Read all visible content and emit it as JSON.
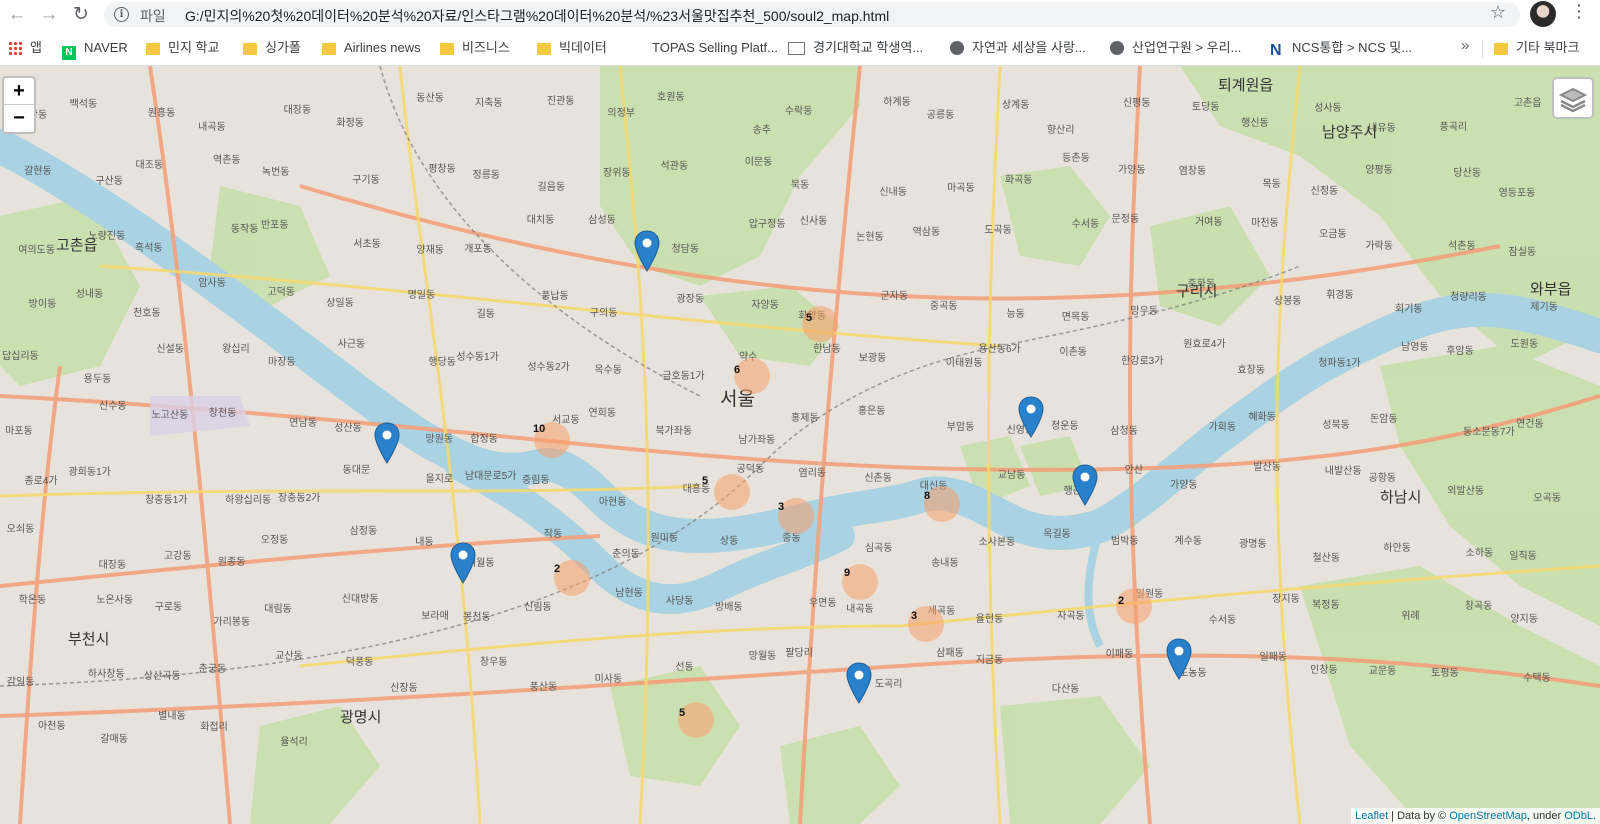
{
  "browser": {
    "scheme_label": "파일",
    "url": "G:/민지의%20첫%20데이터%20분석%20자료/인스타그램%20데이터%20분석/%23서울맛집추천_500/soul2_map.html",
    "bookmarks": [
      {
        "label": "앱",
        "icon": "apps-grid-icon"
      },
      {
        "label": "NAVER",
        "icon": "naver-icon"
      },
      {
        "label": "민지 학교",
        "icon": "folder-icon"
      },
      {
        "label": "싱가폴",
        "icon": "folder-icon"
      },
      {
        "label": "Airlines news",
        "icon": "folder-icon"
      },
      {
        "label": "비즈니스",
        "icon": "folder-icon"
      },
      {
        "label": "빅데이터",
        "icon": "folder-icon"
      },
      {
        "label": "TOPAS Selling Platf...",
        "icon": "none"
      },
      {
        "label": "경기대학교 학생역...",
        "icon": "mail-icon"
      },
      {
        "label": "자연과 세상을 사랑...",
        "icon": "globe-icon"
      },
      {
        "label": "산업연구원 > 우리...",
        "icon": "globe-icon"
      },
      {
        "label": "NCS통합 > NCS 및...",
        "icon": "ncs-icon"
      },
      {
        "label": "기타 북마크",
        "icon": "folder-icon"
      }
    ],
    "more_label": "»"
  },
  "map": {
    "zoom_in": "+",
    "zoom_out": "−",
    "clusters": [
      {
        "count": "5"
      },
      {
        "count": "6"
      },
      {
        "count": "10"
      },
      {
        "count": "5"
      },
      {
        "count": "3"
      },
      {
        "count": "8"
      },
      {
        "count": "2"
      },
      {
        "count": "9"
      },
      {
        "count": "3"
      },
      {
        "count": "2"
      },
      {
        "count": "5"
      }
    ],
    "marker_count": 8,
    "marker_color": "#2a81cb",
    "cluster_color": "#f79e69",
    "cities": [
      "퇴계원읍",
      "남양주시",
      "구리시",
      "와부읍",
      "하남시",
      "서울",
      "고촌읍",
      "부천시",
      "광명시"
    ],
    "places": [
      "장항동",
      "백석동",
      "원흥동",
      "내곡동",
      "대장동",
      "화정동",
      "동산동",
      "지축동",
      "진관동",
      "의정부",
      "호원동",
      "송추",
      "수락동",
      "하계동",
      "공릉동",
      "상계동",
      "향산리",
      "신평동",
      "토당동",
      "행신동",
      "성사동",
      "내유동",
      "풍곡리",
      "고촌읍",
      "갈현동",
      "구산동",
      "대조동",
      "역촌동",
      "녹번동",
      "구기동",
      "평창동",
      "정릉동",
      "길음동",
      "장위동",
      "석관동",
      "이문동",
      "묵동",
      "신내동",
      "마곡동",
      "화곡동",
      "등촌동",
      "가양동",
      "염창동",
      "목동",
      "신정동",
      "양평동",
      "당산동",
      "영등포동",
      "여의도동",
      "노량진동",
      "흑석동",
      "동작동",
      "반포동",
      "서초동",
      "양재동",
      "개포동",
      "대치동",
      "삼성동",
      "청담동",
      "압구정동",
      "신사동",
      "논현동",
      "역삼동",
      "도곡동",
      "수서동",
      "문정동",
      "거여동",
      "마천동",
      "오금동",
      "가락동",
      "석촌동",
      "잠실동",
      "방이동",
      "성내동",
      "천호동",
      "암사동",
      "고덕동",
      "상일동",
      "명일동",
      "길동",
      "풍납동",
      "구의동",
      "광장동",
      "자양동",
      "화양동",
      "군자동",
      "중곡동",
      "능동",
      "면목동",
      "망우동",
      "중화동",
      "상봉동",
      "휘경동",
      "회기동",
      "청량리동",
      "제기동",
      "답십리동",
      "용두동",
      "신설동",
      "왕십리",
      "마장동",
      "사근동",
      "행당동",
      "성수동1가",
      "성수동2가",
      "옥수동",
      "금호동1가",
      "약수",
      "한남동",
      "보광동",
      "이태원동",
      "용산동6가",
      "이촌동",
      "한강로3가",
      "원효로4가",
      "효창동",
      "청파동1가",
      "남영동",
      "후암동",
      "도원동",
      "마포동",
      "신수동",
      "노고산동",
      "창천동",
      "연남동",
      "성산동",
      "망원동",
      "합정동",
      "서교동",
      "연희동",
      "북가좌동",
      "남가좌동",
      "홍제동",
      "홍은동",
      "부암동",
      "신영동",
      "청운동",
      "삼청동",
      "가회동",
      "혜화동",
      "성북동",
      "돈암동",
      "동소문동7가",
      "연건동",
      "종로4가",
      "광희동1가",
      "창충동1가",
      "하왕십리동",
      "장충동2가",
      "동대문",
      "을지로",
      "남대문로5가",
      "중림동",
      "아현동",
      "대흥동",
      "공덕동",
      "염리동",
      "신촌동",
      "대신동",
      "교남동",
      "행촌동",
      "안산",
      "가양동",
      "발산동",
      "내발산동",
      "공항동",
      "외발산동",
      "오곡동",
      "오쇠동",
      "대장동",
      "고강동",
      "원종동",
      "오정동",
      "삼정동",
      "내동",
      "여월동",
      "작동",
      "춘의동",
      "원미동",
      "상동",
      "중동",
      "심곡동",
      "송내동",
      "소사본동",
      "옥길동",
      "범박동",
      "계수동",
      "광명동",
      "철산동",
      "하안동",
      "소하동",
      "일직동",
      "학온동",
      "노온사동",
      "구로동",
      "가리봉동",
      "대림동",
      "신대방동",
      "보라매",
      "봉천동",
      "신림동",
      "남현동",
      "사당동",
      "방배동",
      "우면동",
      "내곡동",
      "세곡동",
      "율현동",
      "자곡동",
      "일원동",
      "수서동",
      "장지동",
      "복정동",
      "위례",
      "창곡동",
      "양지동",
      "감일동",
      "하사창동",
      "상산곡동",
      "춘궁동",
      "교산동",
      "덕풍동",
      "신장동",
      "창우동",
      "풍산동",
      "미사동",
      "선동",
      "망월동",
      "팔당리",
      "도곡리",
      "삼패동",
      "지금동",
      "다산동",
      "이패동",
      "도농동",
      "일패동",
      "인창동",
      "교문동",
      "토평동",
      "수택동",
      "아천동",
      "갈매동",
      "별내동",
      "화접리",
      "율석리"
    ]
  },
  "attribution": {
    "leaflet": "Leaflet",
    "data_by": " | Data by © ",
    "osm": "OpenStreetMap",
    "under": ", under ",
    "odbl": "ODbL."
  }
}
